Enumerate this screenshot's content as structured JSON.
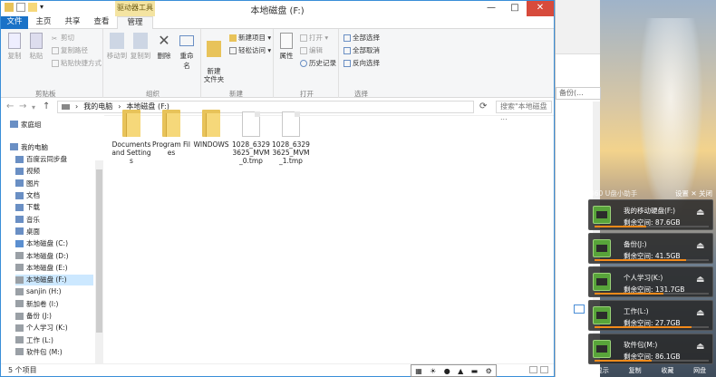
{
  "window": {
    "title": "本地磁盘 (F:)",
    "context_tab": "驱动器工具",
    "controls": {
      "min": "—",
      "max": "□",
      "close": "✕"
    }
  },
  "tabs": [
    {
      "label": "文件"
    },
    {
      "label": "主页"
    },
    {
      "label": "共享"
    },
    {
      "label": "查看"
    },
    {
      "label": "管理"
    }
  ],
  "ribbon": {
    "clipboard": {
      "copy": "复制",
      "paste": "粘贴",
      "cut": "剪切",
      "copy_path": "复制路径",
      "paste_shortcut": "粘贴快捷方式",
      "group": "剪贴板"
    },
    "organize": {
      "move_to": "移动到",
      "copy_to": "复制到",
      "delete": "删除",
      "rename": "重命名",
      "group": "组织"
    },
    "new": {
      "new_folder": "新建\n文件夹",
      "new_item": "新建项目 ▾",
      "easy_access": "轻松访问 ▾",
      "group": "新建"
    },
    "open": {
      "properties": "属性",
      "open": "打开 ▾",
      "edit": "编辑",
      "history": "历史记录",
      "group": "打开"
    },
    "select": {
      "select_all": "全部选择",
      "select_none": "全部取消",
      "invert": "反向选择",
      "group": "选择"
    }
  },
  "address": {
    "crumbs": [
      "我的电脑",
      "本地磁盘 (F:)"
    ],
    "search_placeholder": "搜索\"本地磁盘 ...",
    "bg_search": "备份(...",
    "nav": {
      "back": "←",
      "forward": "→",
      "recent": "▾",
      "up": "↑",
      "refresh": "⟳"
    }
  },
  "navpane": [
    {
      "label": "家庭组",
      "icon": "homegroup-icon",
      "indent": 0
    },
    {
      "label": "我的电脑",
      "icon": "computer-icon",
      "indent": 0
    },
    {
      "label": "百度云同步盘",
      "icon": "cloud-icon",
      "indent": 1
    },
    {
      "label": "视频",
      "icon": "video-icon",
      "indent": 1
    },
    {
      "label": "图片",
      "icon": "pictures-icon",
      "indent": 1
    },
    {
      "label": "文档",
      "icon": "documents-icon",
      "indent": 1
    },
    {
      "label": "下载",
      "icon": "download-icon",
      "indent": 1
    },
    {
      "label": "音乐",
      "icon": "music-icon",
      "indent": 1
    },
    {
      "label": "桌面",
      "icon": "desktop-icon",
      "indent": 1
    },
    {
      "label": "本地磁盘 (C:)",
      "icon": "windows-drive-icon",
      "indent": 1
    },
    {
      "label": "本地磁盘 (D:)",
      "icon": "drive-icon",
      "indent": 1
    },
    {
      "label": "本地磁盘 (E:)",
      "icon": "drive-icon",
      "indent": 1
    },
    {
      "label": "本地磁盘 (F:)",
      "icon": "drive-icon",
      "indent": 1,
      "selected": true
    },
    {
      "label": "sanjin (H:)",
      "icon": "drive-icon",
      "indent": 1
    },
    {
      "label": "新加卷 (I:)",
      "icon": "drive-icon",
      "indent": 1
    },
    {
      "label": "备份 (J:)",
      "icon": "drive-icon",
      "indent": 1
    },
    {
      "label": "个人学习 (K:)",
      "icon": "drive-icon",
      "indent": 1
    },
    {
      "label": "工作 (L:)",
      "icon": "drive-icon",
      "indent": 1
    },
    {
      "label": "软件包 (M:)",
      "icon": "drive-icon",
      "indent": 1
    }
  ],
  "files": [
    {
      "name": "Documents and Settings",
      "type": "folder-locked"
    },
    {
      "name": "Program Files",
      "type": "folder"
    },
    {
      "name": "WINDOWS",
      "type": "folder"
    },
    {
      "name": "1028_63293625_MVM_0.tmp",
      "type": "file"
    },
    {
      "name": "1028_63293625_MVM_1.tmp",
      "type": "file"
    }
  ],
  "status": {
    "count": "5 个项目"
  },
  "usb_panel": {
    "header": "360 U盘小助手",
    "header_right": "设置  ✕ 关闭",
    "drives": [
      {
        "name": "我的移动硬盘(F:)",
        "free": "剩余空间: 87.6GB",
        "used_fraction": 0.45
      },
      {
        "name": "备份(J:)",
        "free": "剩余空间: 41.5GB",
        "used_fraction": 0.8
      },
      {
        "name": "个人学习(K:)",
        "free": "剩余空间: 131.7GB",
        "used_fraction": 0.6
      },
      {
        "name": "工作(L:)",
        "free": "剩余空间: 27.7GB",
        "used_fraction": 0.85
      },
      {
        "name": "软件包(M:)",
        "free": "剩余空间: 86.1GB",
        "used_fraction": 0.5
      }
    ],
    "footer": [
      "显示",
      "复制",
      "收藏",
      "网盘"
    ]
  },
  "tray": [
    "▦",
    "☀",
    "●",
    "▲",
    "▬",
    "⚙"
  ],
  "colors": {
    "accent": "#1a72c7",
    "close": "#d74b3c",
    "context_tab": "#f4e4a2",
    "usb_bar": "#f28a1a"
  }
}
